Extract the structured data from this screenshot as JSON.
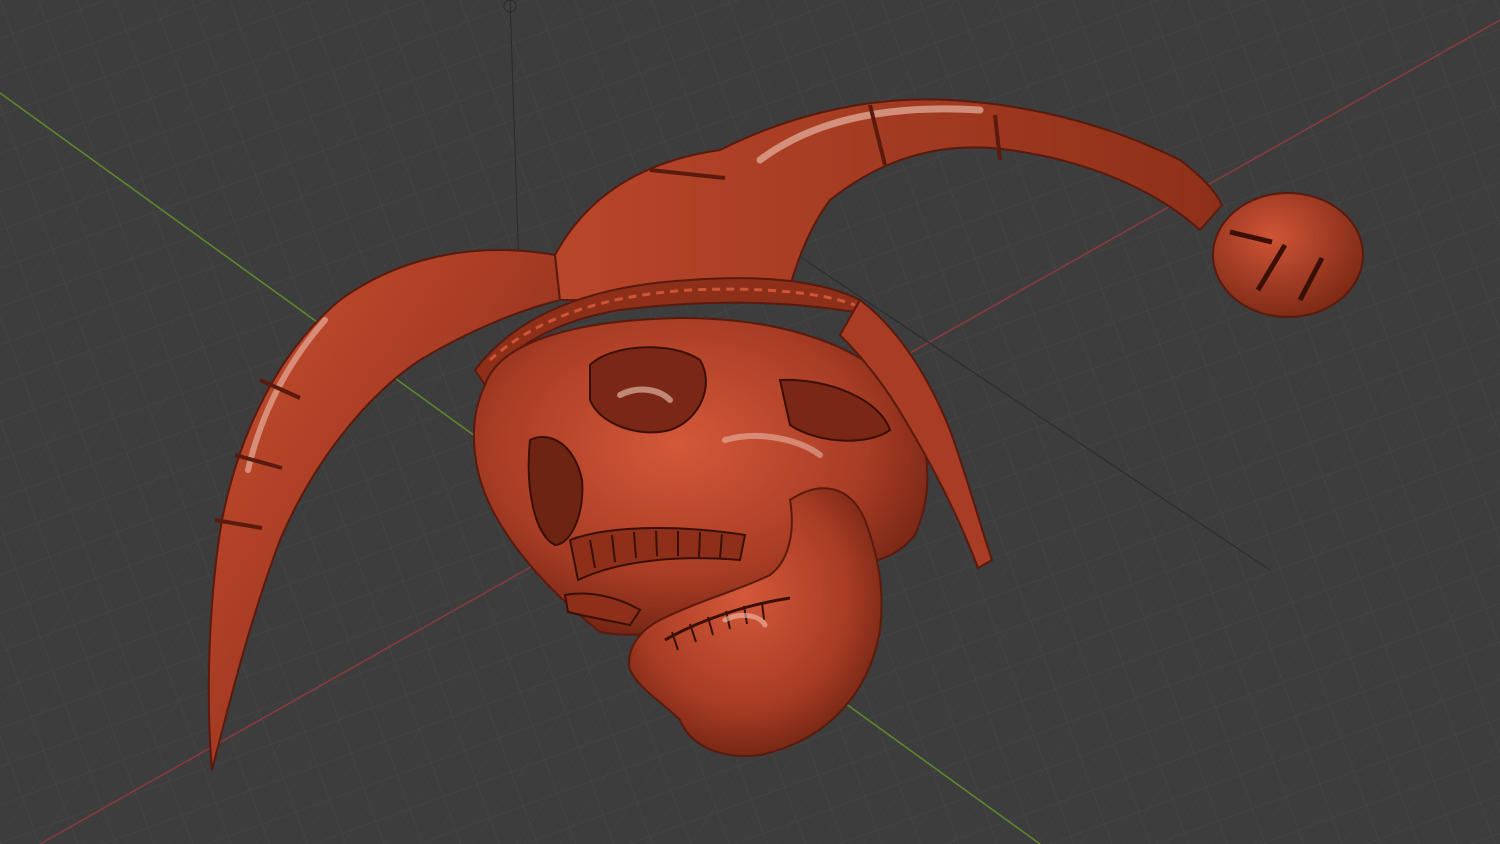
{
  "viewport": {
    "name": "3D Viewport",
    "shading": "solid",
    "object": "jester-skull-model",
    "colors": {
      "background": "#3d3d3d",
      "grid_line": "#484848",
      "axis_x": "#8a3a3e",
      "axis_y": "#5e8a2a",
      "model_base": "#b5432a",
      "model_dark": "#5a1a0e",
      "model_highlight": "#f2c8b8"
    }
  }
}
